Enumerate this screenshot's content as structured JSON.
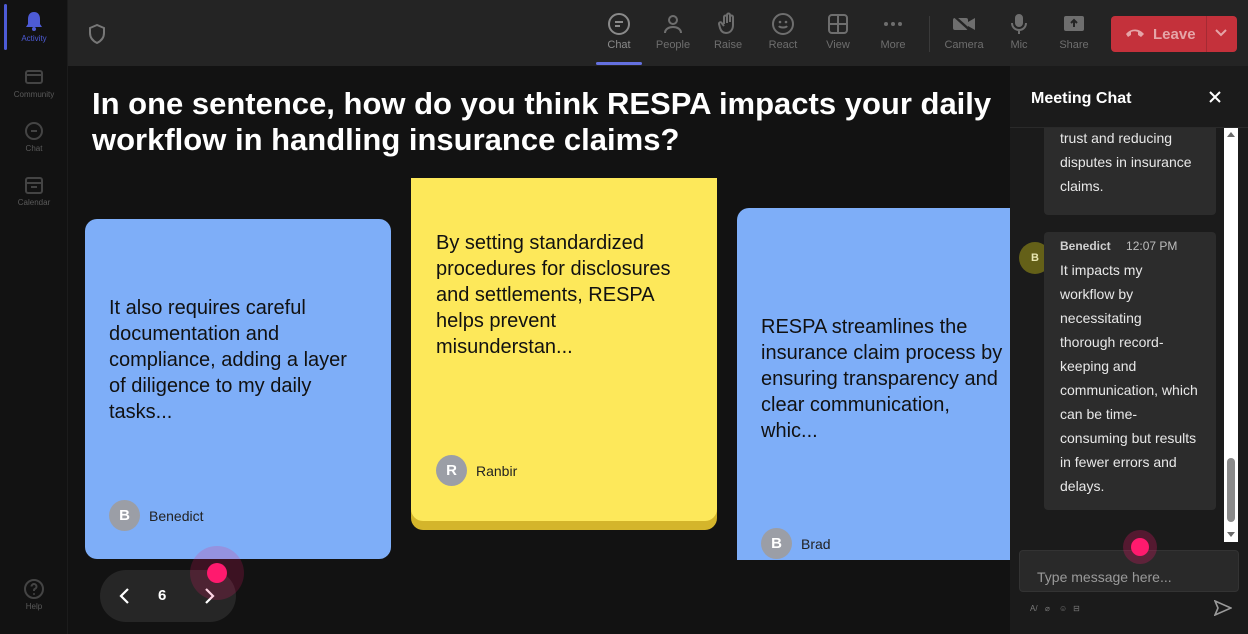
{
  "rail": {
    "items": [
      {
        "label": "Activity",
        "icon": "bell-icon",
        "active": true
      },
      {
        "label": "Community",
        "icon": "community-icon"
      },
      {
        "label": "Chat",
        "icon": "chat-icon"
      },
      {
        "label": "Calendar",
        "icon": "calendar-icon"
      },
      {
        "label": "Help",
        "icon": "help-icon"
      }
    ]
  },
  "toolbar": {
    "buttons": [
      {
        "label": "Chat",
        "icon": "chat-icon",
        "active": true
      },
      {
        "label": "People",
        "icon": "people-icon"
      },
      {
        "label": "Raise",
        "icon": "raise-hand-icon"
      },
      {
        "label": "React",
        "icon": "smiley-icon"
      },
      {
        "label": "View",
        "icon": "grid-icon"
      },
      {
        "label": "More",
        "icon": "more-icon"
      },
      {
        "label": "Camera",
        "icon": "camera-off-icon"
      },
      {
        "label": "Mic",
        "icon": "mic-icon"
      },
      {
        "label": "Share",
        "icon": "share-icon"
      }
    ],
    "leave_label": "Leave",
    "leave_color": "#c4313b"
  },
  "stage": {
    "question": "In one sentence, how do you think RESPA impacts your daily workflow in handling insurance claims?",
    "notes": [
      {
        "text": "It also requires careful documentation and compliance, adding a layer of diligence to my daily tasks...",
        "author": "Benedict",
        "initial": "B",
        "color": "#7eaef8"
      },
      {
        "text": "By setting standardized procedures for disclosures and settlements, RESPA helps prevent misunderstan...",
        "author": "Ranbir",
        "initial": "R",
        "color": "#fde85a"
      },
      {
        "text": "RESPA streamlines the insurance claim process by ensuring transparency and clear communication, whic...",
        "author": "Brad",
        "initial": "B",
        "color": "#7eaef8"
      }
    ],
    "page": "6"
  },
  "chat": {
    "title": "Meeting Chat",
    "messages": [
      {
        "text": "trust and reducing disputes in insurance claims."
      },
      {
        "sender": "Benedict",
        "initial": "B",
        "time": "12:07 PM",
        "text": "It impacts my workflow by necessitating thorough record-keeping and communication, which can be time-consuming but results in fewer errors and delays."
      }
    ],
    "input_placeholder": "Type message here..."
  }
}
